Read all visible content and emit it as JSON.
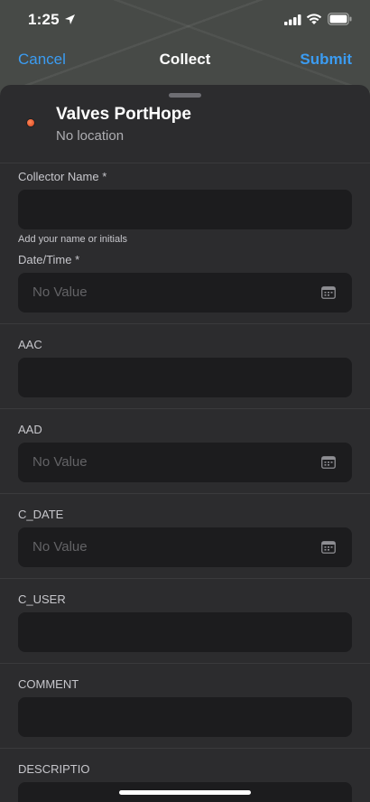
{
  "status": {
    "time": "1:25"
  },
  "nav": {
    "cancel_label": "Cancel",
    "title": "Collect",
    "submit_label": "Submit"
  },
  "feature": {
    "title": "Valves PortHope",
    "subtitle": "No location"
  },
  "fields": [
    {
      "label": "Collector Name  *",
      "value": "",
      "placeholder": "",
      "hint": "Add your name or initials",
      "type": "text"
    },
    {
      "label": "Date/Time *",
      "value": "",
      "placeholder": "No Value",
      "type": "date"
    },
    {
      "label": "AAC",
      "value": "",
      "placeholder": "",
      "type": "text"
    },
    {
      "label": "AAD",
      "value": "",
      "placeholder": "No Value",
      "type": "date"
    },
    {
      "label": "C_DATE",
      "value": "",
      "placeholder": "No Value",
      "type": "date"
    },
    {
      "label": "C_USER",
      "value": "",
      "placeholder": "",
      "type": "text"
    },
    {
      "label": "COMMENT",
      "value": "",
      "placeholder": "",
      "type": "text"
    },
    {
      "label": "DESCRIPTIO",
      "value": "",
      "placeholder": "",
      "type": "text"
    }
  ],
  "colors": {
    "accent": "#3b9cf2",
    "sheet_background": "#2c2c2e",
    "field_background": "#1c1c1e",
    "layer_dot": "#d8411b"
  },
  "icons": {
    "location": "location-arrow-icon",
    "signal": "cellular-signal-icon",
    "wifi": "wifi-icon",
    "battery": "battery-icon",
    "calendar": "calendar-icon"
  }
}
